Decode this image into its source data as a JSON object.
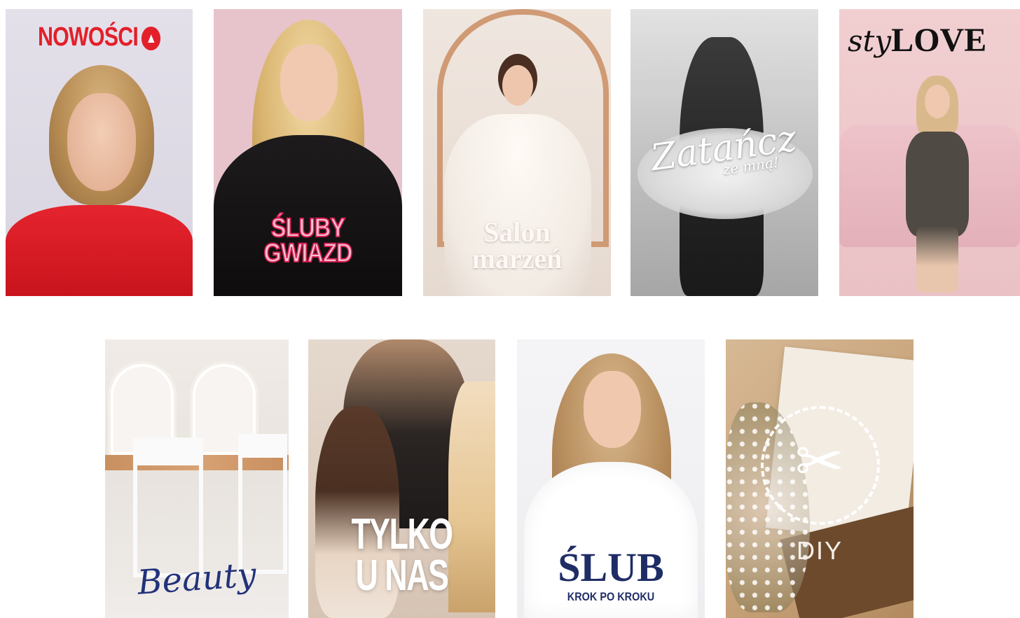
{
  "tiles": [
    {
      "title": "NOWOŚCI",
      "icon": "fire-icon",
      "accent": "#e3202a"
    },
    {
      "title_line1": "ŚLUBY",
      "title_line2": "GWIAZD",
      "accent": "#d61f57"
    },
    {
      "title_line1": "Salon",
      "title_line2": "marzeń"
    },
    {
      "title": "Zatańcz",
      "subtitle": "ze mną!"
    },
    {
      "title_prefix": "sty",
      "title_suffix": "LOVE"
    },
    {
      "title": "Beauty",
      "accent": "#22327a"
    },
    {
      "title_line1": "TYLKO",
      "title_line2": "U NAS"
    },
    {
      "title": "ŚLUB",
      "subtitle": "KROK PO KROKU",
      "accent": "#1f2d66"
    },
    {
      "title": "DIY",
      "icon": "scissors-icon"
    }
  ]
}
